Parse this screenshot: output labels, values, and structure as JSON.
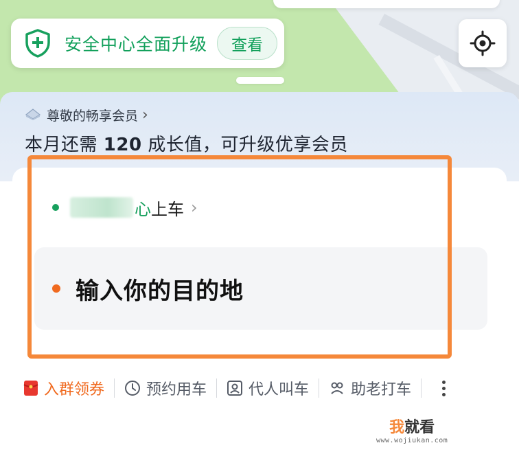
{
  "safety": {
    "text": "安全中心全面升级",
    "view_label": "查看"
  },
  "member": {
    "title": "尊敬的畅享会员",
    "info_prefix": "本月还需",
    "info_number": "120",
    "info_suffix": "成长值，可升级优享会员"
  },
  "route": {
    "pickup_visible_char": "心",
    "pickup_suffix": "上车",
    "destination_placeholder": "输入你的目的地"
  },
  "quick_actions": [
    {
      "label": "入群领券",
      "icon": "red-envelope-icon"
    },
    {
      "label": "预约用车",
      "icon": "clock-icon"
    },
    {
      "label": "代人叫车",
      "icon": "person-card-icon"
    },
    {
      "label": "助老打车",
      "icon": "elder-icon"
    }
  ],
  "watermark": {
    "main_a": "我",
    "main_b": "就看",
    "sub": "www.wojiukan.com"
  },
  "colors": {
    "green": "#17a05d",
    "orange": "#f06a1f",
    "highlight": "#f5883a"
  }
}
